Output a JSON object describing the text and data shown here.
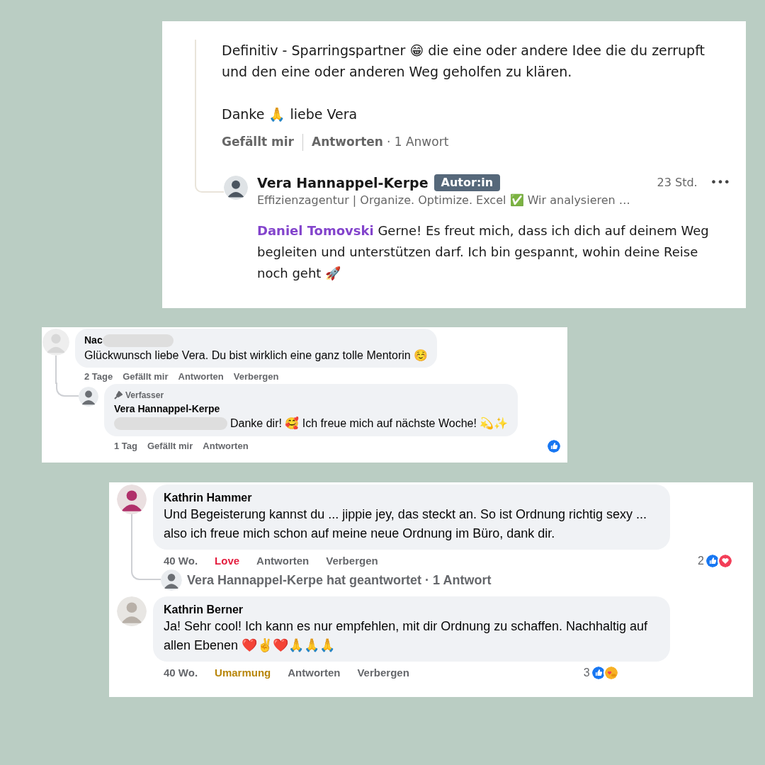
{
  "linkedin_thread": {
    "comment": {
      "paragraphs": [
        "Definitiv - Sparringspartner 😁 die eine oder andere Idee die du zerrupft und den eine oder anderen Weg geholfen zu klären.",
        "Danke 🙏 liebe Vera"
      ],
      "actions": {
        "like": "Gefällt mir",
        "reply": "Antworten",
        "reply_count": "· 1 Anwort"
      }
    },
    "reply": {
      "author": "Vera Hannappel-Kerpe",
      "badge": "Autor:in",
      "time": "23 Std.",
      "more": "•••",
      "headline": "Effizienzagentur | Organize. Optimize. Excel ✅ Wir analysieren …",
      "mention": "Daniel Tomovski",
      "text": "Gerne! Es freut mich, dass ich dich auf deinem Weg begleiten und unterstützen darf. Ich bin gespannt, wohin deine Reise noch geht 🚀"
    }
  },
  "facebook_thread_1": {
    "comment": {
      "author": "Nac",
      "author_redacted": true,
      "text": "Glückwunsch liebe Vera. Du bist wirklich eine ganz tolle Mentorin ☺️",
      "actions": [
        "2 Tage",
        "Gefällt mir",
        "Antworten",
        "Verbergen"
      ]
    },
    "reply": {
      "role": "Verfasser",
      "author": "Vera Hannappel-Kerpe",
      "mention_redacted": true,
      "text": "Danke dir! 🥰 Ich freue mich auf nächste Woche! 💫✨",
      "actions": [
        "1 Tag",
        "Gefällt mir",
        "Antworten"
      ],
      "reactions": [
        {
          "kind": "like"
        }
      ]
    }
  },
  "facebook_thread_2": {
    "comments": [
      {
        "author": "Kathrin Hammer",
        "text": "Und Begeisterung kannst du ... jippie jey, das steckt an. So ist Ordnung richtig sexy ... also ich freue mich schon auf meine neue Ordnung im Büro, dank dir.",
        "time": "40 Wo.",
        "reaction": {
          "label": "Love",
          "color": "#e41e3f"
        },
        "actions": [
          "Antworten",
          "Verbergen"
        ],
        "reaction_count": "2",
        "reactions": [
          {
            "kind": "like"
          },
          {
            "kind": "love"
          }
        ],
        "replies_summary": "Vera Hannappel-Kerpe hat geantwortet · 1 Antwort"
      },
      {
        "author": "Kathrin Berner",
        "text": "Ja! Sehr cool! Ich kann es nur empfehlen, mit dir Ordnung zu schaffen. Nachhaltig auf allen Ebenen ❤️✌️❤️🙏🙏🙏",
        "time": "40 Wo.",
        "reaction": {
          "label": "Umarmung",
          "color": "#b8860b"
        },
        "actions": [
          "Antworten",
          "Verbergen"
        ],
        "reaction_count": "3",
        "reactions": [
          {
            "kind": "like"
          },
          {
            "kind": "care"
          }
        ]
      }
    ]
  }
}
